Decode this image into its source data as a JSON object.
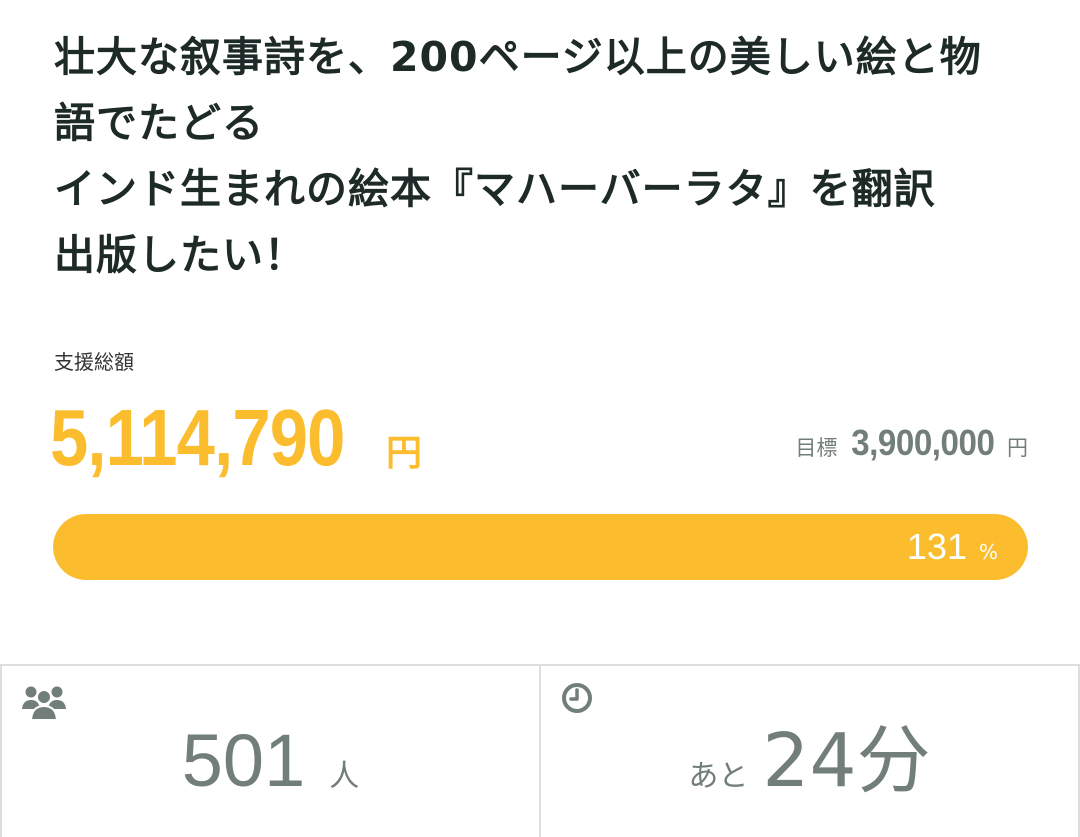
{
  "project": {
    "title_lines": [
      "壮大な叙事詩を、200ページ以上の美しい絵と物",
      "語でたどる",
      "インド生まれの絵本『マハーバーラタ』を翻訳",
      "出版したい！"
    ]
  },
  "funding": {
    "total_label": "支援総額",
    "amount": "5,114,790",
    "amount_unit": "円",
    "goal_label": "目標",
    "goal_amount": "3,900,000",
    "goal_unit": "円",
    "progress_percent": 131,
    "progress_text": "131",
    "progress_unit": "%"
  },
  "stats": {
    "supporters_icon": "users-icon",
    "supporters_count": "501",
    "supporters_unit": "人",
    "time_icon": "clock-icon",
    "time_prefix": "あと",
    "time_remaining": "24分"
  },
  "colors": {
    "accent": "#fbbd2e",
    "muted": "#727e7a",
    "border": "#dcdfde",
    "text": "#1e2a27"
  }
}
